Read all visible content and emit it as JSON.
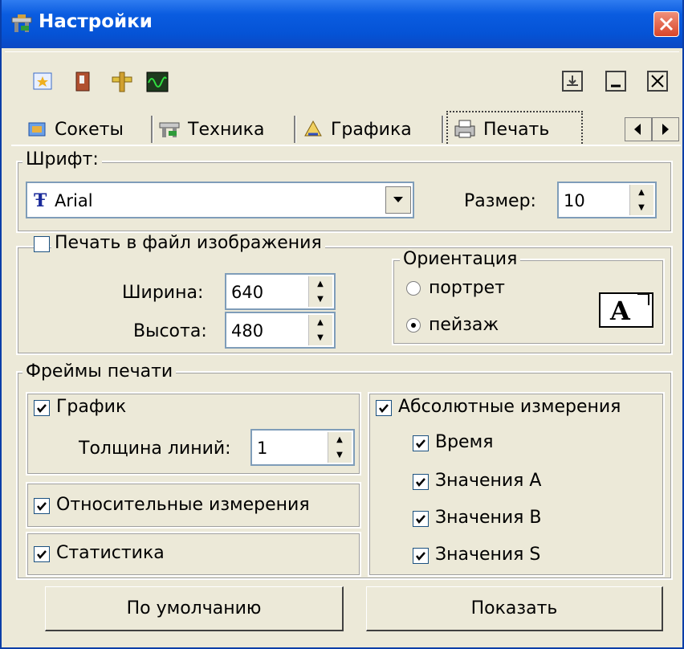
{
  "window": {
    "title": "Настройки"
  },
  "toolbar": {
    "left_icons": [
      "favorites-icon",
      "book-icon",
      "ruler-icon",
      "oscilloscope-icon"
    ],
    "right_icons": [
      "print-icon",
      "minimize-icon",
      "close-box-icon"
    ]
  },
  "tabs": [
    {
      "label": "Сокеты",
      "icon": "socket-icon"
    },
    {
      "label": "Техника",
      "icon": "equipment-icon"
    },
    {
      "label": "Графика",
      "icon": "graphics-icon"
    },
    {
      "label": "Печать",
      "icon": "printer-icon",
      "active": true
    }
  ],
  "font_group": {
    "legend": "Шрифт:",
    "font_value": "Arial",
    "size_label": "Размер:",
    "size_value": "10"
  },
  "image_group": {
    "checkbox_label": "Печать в файл изображения",
    "checked": false,
    "width_label": "Ширина:",
    "width_value": "640",
    "height_label": "Высота:",
    "height_value": "480"
  },
  "orientation": {
    "legend": "Ориентация",
    "portrait_label": "портрет",
    "landscape_label": "пейзаж",
    "selected": "landscape",
    "preview_glyph": "A"
  },
  "frames": {
    "legend": "Фреймы печати",
    "graph_label": "График",
    "line_width_label": "Толщина линий:",
    "line_width_value": "1",
    "relative_label": "Относительные измерения",
    "stats_label": "Статистика",
    "absolute_label": "Абсолютные измерения",
    "time_label": "Время",
    "values_a_label": "Значения A",
    "values_b_label": "Значения B",
    "values_s_label": "Значения S"
  },
  "buttons": {
    "default_label": "По умолчанию",
    "show_label": "Показать"
  },
  "colors": {
    "titlebar": "#0553d6",
    "face": "#ece9d8",
    "close": "#d8452a"
  }
}
